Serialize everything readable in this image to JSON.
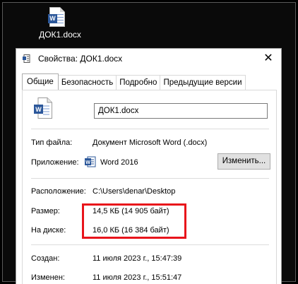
{
  "desktop": {
    "icon": "word-document-icon",
    "file_label": "ДОК1.docx"
  },
  "dialog": {
    "title": "Свойства: ДОК1.docx",
    "close_glyph": "✕",
    "tabs": [
      "Общие",
      "Безопасность",
      "Подробно",
      "Предыдущие версии"
    ],
    "file_name_value": "ДОК1.docx",
    "file_type_label": "Тип файла:",
    "file_type_value": "Документ Microsoft Word (.docx)",
    "app_label": "Приложение:",
    "app_value": "Word 2016",
    "change_button": "Изменить...",
    "location_label": "Расположение:",
    "location_value": "C:\\Users\\denar\\Desktop",
    "size_label": "Размер:",
    "size_value": "14,5 КБ (14 905 байт)",
    "disk_label": "На диске:",
    "disk_value": "16,0 КБ (16 384 байт)",
    "created_label": "Создан:",
    "created_value": "11 июля 2023 г., 15:47:39",
    "modified_label": "Изменен:",
    "modified_value": "11 июля 2023 г., 15:51:47"
  },
  "colors": {
    "highlight": "#e8141b",
    "word_blue": "#2b579a"
  }
}
